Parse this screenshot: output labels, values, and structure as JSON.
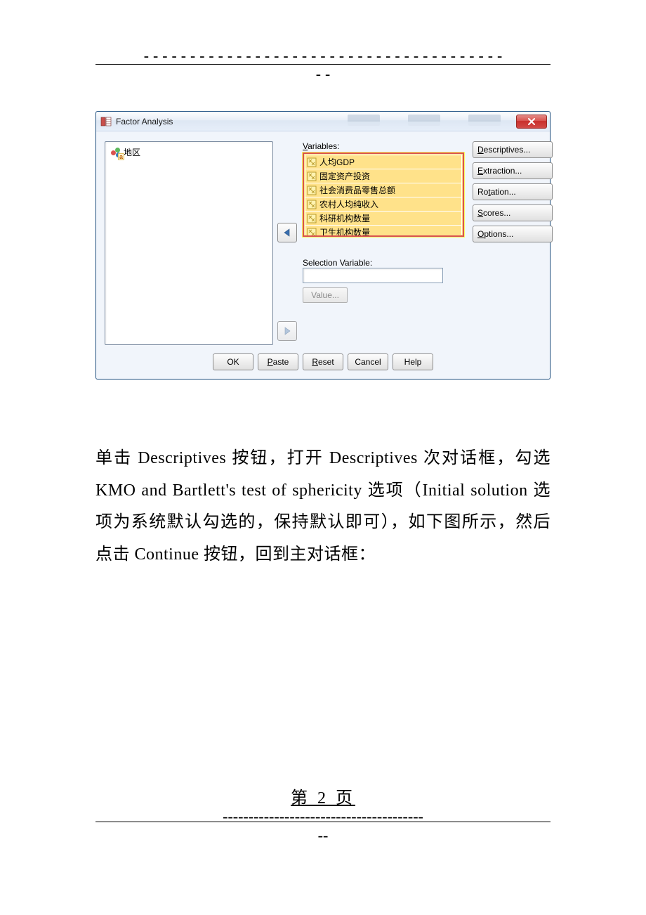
{
  "header_rule": {
    "dashes": "---------------------------------------",
    "tail": "--"
  },
  "dialog": {
    "title": "Factor Analysis",
    "close": "x",
    "left_variable": "地区",
    "variables_label_pre": "V",
    "variables_label_rest": "ariables:",
    "variables": [
      "人均GDP",
      "固定资产投资",
      "社会消费品零售总额",
      "农村人均纯收入",
      "科研机构数量",
      "卫生机构数量"
    ],
    "selection_label_pre": "Sele",
    "selection_underline": "c",
    "selection_label_post": "tion Variable:",
    "value_btn_pre": "Va",
    "value_btn_ul": "l",
    "value_btn_post": "ue...",
    "side": {
      "descriptives": {
        "ul": "D",
        "rest": "escriptives..."
      },
      "extraction": {
        "ul": "E",
        "rest": "xtraction..."
      },
      "rotation": {
        "pre": "Ro",
        "ul": "t",
        "rest": "ation..."
      },
      "scores": {
        "ul": "S",
        "rest": "cores..."
      },
      "options": {
        "ul": "O",
        "rest": "ptions..."
      }
    },
    "bottom": {
      "ok": "OK",
      "paste": {
        "ul": "P",
        "rest": "aste"
      },
      "reset": {
        "ul": "R",
        "rest": "eset"
      },
      "cancel": "Cancel",
      "help": "Help"
    }
  },
  "paragraph": "单击 Descriptives 按钮，打开 Descriptives 次对话框，勾选 KMO and Bartlett's test of sphericity 选项（Initial solution 选项为系统默认勾选的，保持默认即可），如下图所示，然后点击 Continue 按钮，回到主对话框：",
  "footer": {
    "page": "第 2 页",
    "dashes": "---------------------------------------",
    "tail": "--"
  }
}
